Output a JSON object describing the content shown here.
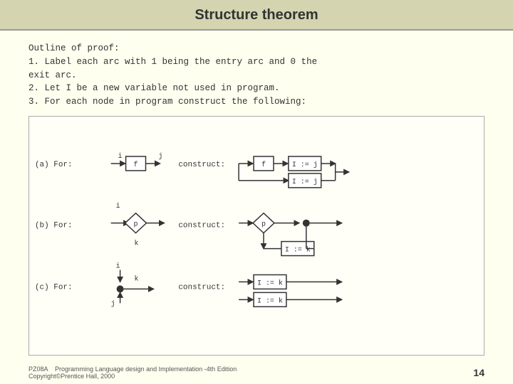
{
  "title": "Structure theorem",
  "outline": {
    "line0": "Outline of proof:",
    "line1": "1.  Label each arc with 1 being the entry arc and 0 the",
    "line2": "    exit arc.",
    "line3": "2.  Let I be a new variable not used in program.",
    "line4": "3.  For each node in program construct the following:"
  },
  "footer": {
    "left_code": "PZ08A",
    "left_text": "Programming Language design and Implementation -4th Edition",
    "left_text2": "Copyright©Prentice Hall, 2000",
    "page_number": "14"
  }
}
